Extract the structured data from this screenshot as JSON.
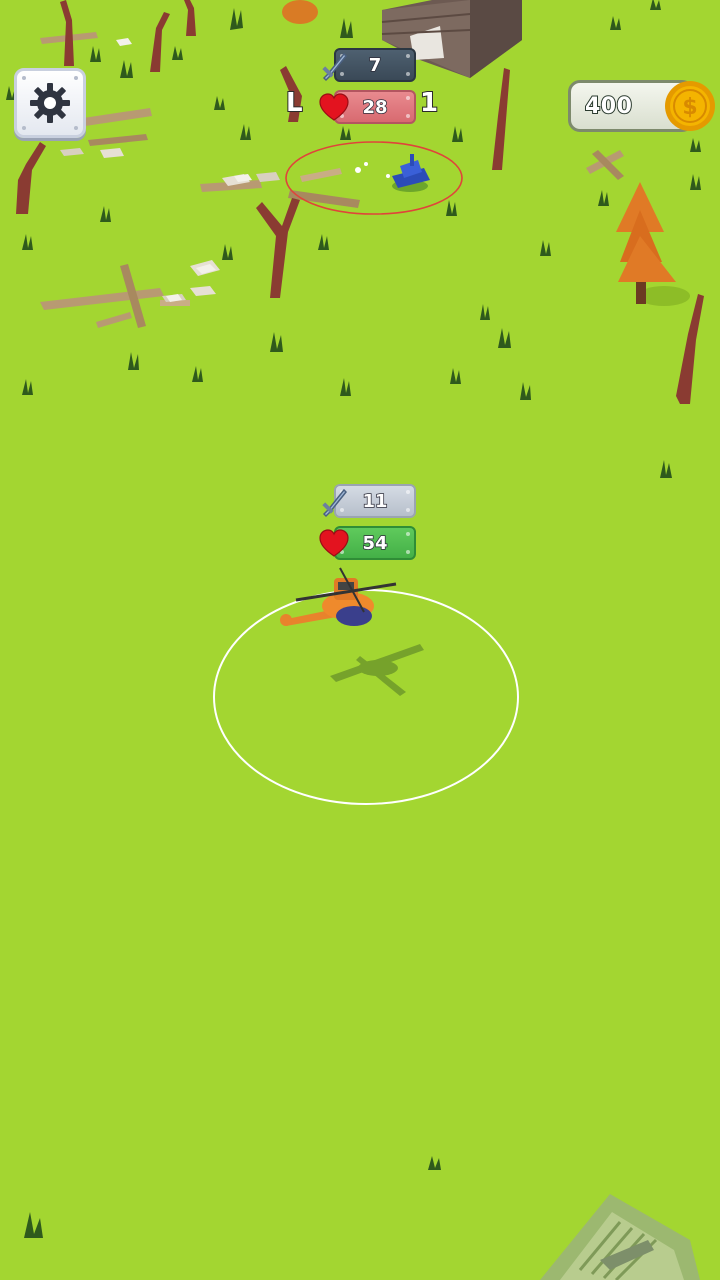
{
  "hud": {
    "settings_icon": "gear-icon",
    "coins": "400",
    "coin_icon": "gold-coin-icon"
  },
  "enemy": {
    "attack": "7",
    "health": "28",
    "side_left": "L",
    "side_right": "1"
  },
  "player": {
    "attack": "11",
    "health": "54"
  },
  "colors": {
    "grass": "#a3d631",
    "enemy_range": "#e0443a",
    "player_range": "#ffffff",
    "coin_gold": "#f4b400"
  }
}
